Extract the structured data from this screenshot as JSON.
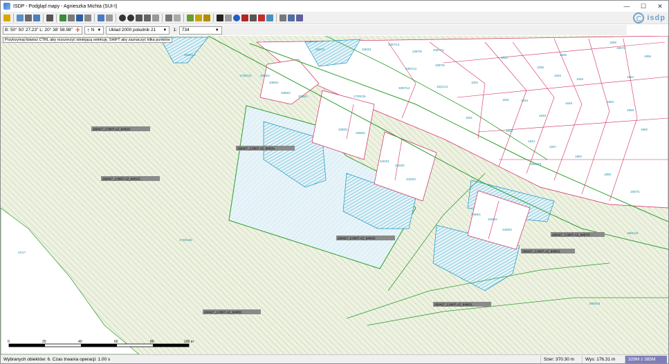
{
  "window": {
    "title": "ISDP - Podgląd mapy - Agnieszka Michta (SUI-I)",
    "controls": [
      "—",
      "☐",
      "✕"
    ]
  },
  "logo": {
    "text": "isdp"
  },
  "coords": {
    "text": "B: 50° 50' 27.23\" L: 20° 38' 58.98\""
  },
  "north": {
    "label": "N"
  },
  "crs": {
    "selected": "Układ 2000 południk 21"
  },
  "scale": {
    "label": "1:",
    "value": "734"
  },
  "hint": "Przytrzymaj klawisz CTRL aby rozszerzyć istniejącą selekcję, SHIFT aby zaznaczyć kilka punktów",
  "parcels": [
    {
      "text": "2608/14",
      "cls": "g"
    },
    {
      "text": "2607/1",
      "cls": "g"
    },
    {
      "text": "3383/1",
      "cls": "g"
    },
    {
      "text": "3387/13",
      "cls": "g"
    },
    {
      "text": "3387/8",
      "cls": "g"
    },
    {
      "text": "3387/11",
      "cls": "g"
    },
    {
      "text": "3387/12",
      "cls": "g"
    },
    {
      "text": "3387/6",
      "cls": "g"
    },
    {
      "text": "3387/14",
      "cls": "g"
    },
    {
      "text": "1822",
      "cls": "g"
    },
    {
      "text": "1823",
      "cls": "g"
    },
    {
      "text": "1836",
      "cls": "g"
    },
    {
      "text": "1835",
      "cls": "g"
    },
    {
      "text": "1845",
      "cls": "g"
    },
    {
      "text": "1846",
      "cls": "g"
    },
    {
      "text": "1854",
      "cls": "g"
    },
    {
      "text": "1855",
      "cls": "g"
    },
    {
      "text": "1856",
      "cls": "g"
    },
    {
      "text": "1857/1",
      "cls": "g"
    },
    {
      "text": "1730/1/2",
      "cls": "g"
    },
    {
      "text": "3385/2",
      "cls": "g"
    },
    {
      "text": "3385/1",
      "cls": "g"
    },
    {
      "text": "3386/2",
      "cls": "g"
    },
    {
      "text": "3386/1",
      "cls": "g"
    },
    {
      "text": "3390/2",
      "cls": "g"
    },
    {
      "text": "3390/1",
      "cls": "g"
    },
    {
      "text": "1821/12",
      "cls": "g"
    },
    {
      "text": "1831",
      "cls": "g"
    },
    {
      "text": "1834",
      "cls": "g"
    },
    {
      "text": "1848",
      "cls": "g"
    },
    {
      "text": "1849",
      "cls": "g"
    },
    {
      "text": "1853",
      "cls": "g"
    },
    {
      "text": "1858",
      "cls": "g"
    },
    {
      "text": "1860",
      "cls": "g"
    },
    {
      "text": "1833",
      "cls": "g"
    },
    {
      "text": "1844",
      "cls": "g"
    },
    {
      "text": "1847",
      "cls": "g"
    },
    {
      "text": "1852",
      "cls": "g"
    },
    {
      "text": "1821",
      "cls": "g"
    },
    {
      "text": "1861/10",
      "cls": "g"
    },
    {
      "text": "1859",
      "cls": "g"
    },
    {
      "text": "1857/1",
      "cls": "g"
    },
    {
      "text": "3403/1",
      "cls": "g"
    },
    {
      "text": "3403/2",
      "cls": "g"
    },
    {
      "text": "3403/3",
      "cls": "g"
    },
    {
      "text": "3469/1",
      "cls": "g"
    },
    {
      "text": "3469/2",
      "cls": "g"
    },
    {
      "text": "3469/3",
      "cls": "g"
    },
    {
      "text": "1730/1/5",
      "cls": "g"
    },
    {
      "text": "41/17",
      "cls": "g"
    },
    {
      "text": "1730/105",
      "cls": "g"
    },
    {
      "text": "1861/34",
      "cls": "g"
    },
    {
      "text": "1860/34",
      "cls": "g"
    }
  ],
  "plates": [
    {
      "text": "260427_2.0007.AZ_8402/2"
    },
    {
      "text": "260427_2.0007.AZ_8401/2"
    },
    {
      "text": "260427_2.0007.AZ_8403/1"
    },
    {
      "text": "260427_2.0007.AZ_8404/2"
    },
    {
      "text": "260427_2.0007.AZ_8407/3"
    },
    {
      "text": "260427_2.0007.AZ_8405/1"
    },
    {
      "text": "260427_2.0007.AZ_8406/1"
    },
    {
      "text": "260427_2.0007.AZ_8408/2"
    }
  ],
  "scalebar": {
    "ticks": [
      "0",
      "20",
      "40",
      "60",
      "80",
      "100 m"
    ]
  },
  "status": {
    "selection": "Wybranych obiektów: 6. Czas trwania operacji: 1.00 s",
    "width": "Szer: 370.30 m",
    "height": "Wys: 176.31 m",
    "mem": "329M z 385M"
  }
}
